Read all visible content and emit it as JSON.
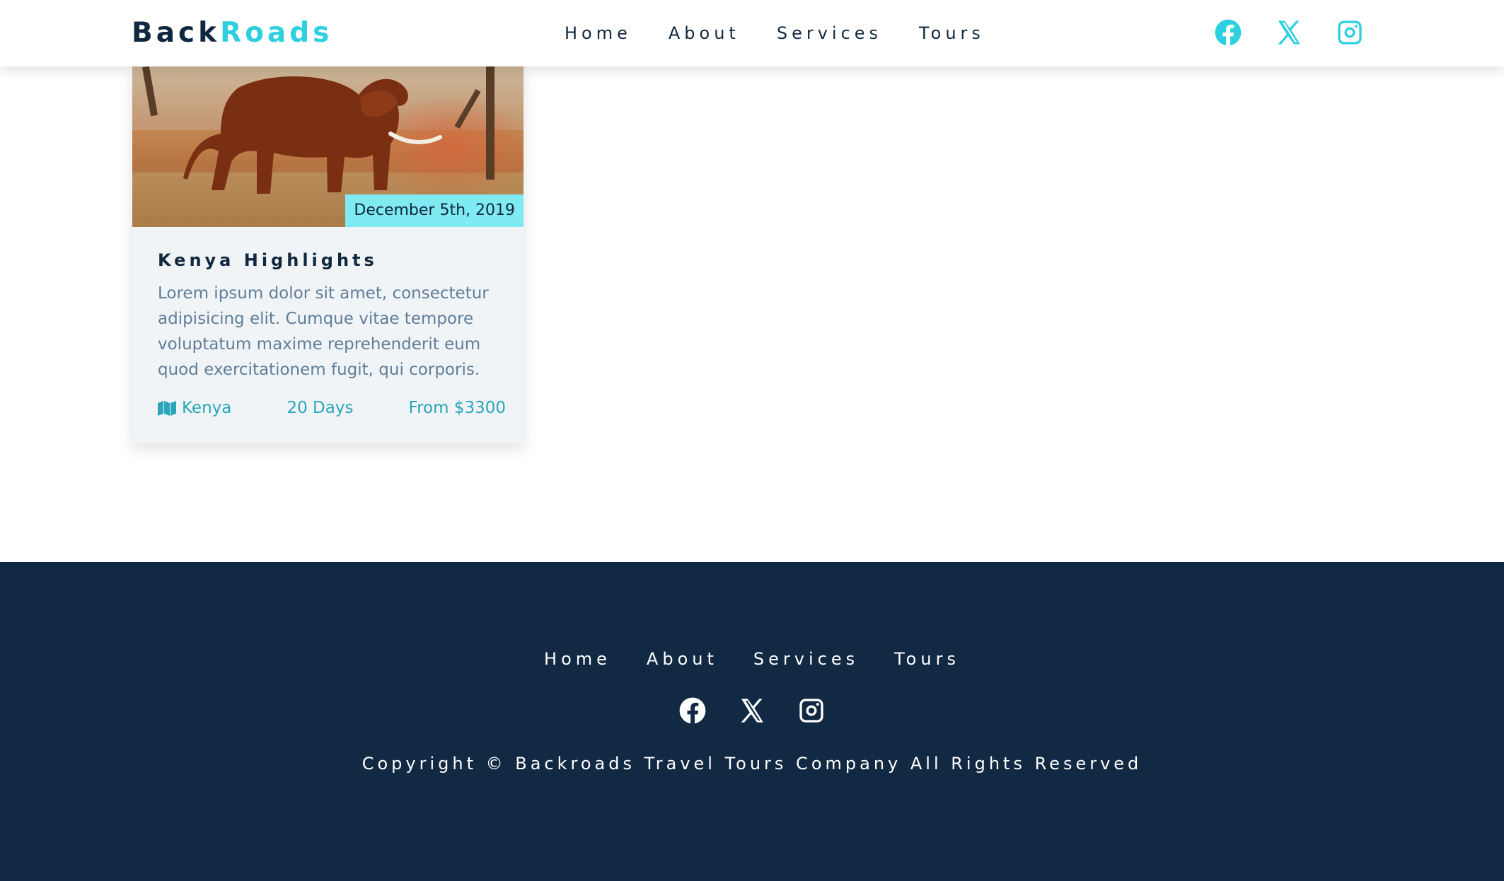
{
  "brand": {
    "part1": "Back",
    "part2": "Roads"
  },
  "nav": {
    "links": [
      "Home",
      "About",
      "Services",
      "Tours"
    ],
    "icons": [
      "facebook-icon",
      "x-icon",
      "instagram-icon"
    ]
  },
  "tour": {
    "date": "December 5th, 2019",
    "title": "Kenya Highlights",
    "description": "Lorem ipsum dolor sit amet, consectetur adipisicing elit. Cumque vitae tempore voluptatum maxime reprehenderit eum quod exercitationem fugit, qui corporis.",
    "location": "Kenya",
    "duration": "20 Days",
    "price": "From $3300",
    "image_alt": "elephant"
  },
  "footer": {
    "links": [
      "Home",
      "About",
      "Services",
      "Tours"
    ],
    "copyright": "Copyright © Backroads Travel Tours Company  All Rights Reserved"
  },
  "colors": {
    "primary": "#2ed0e0",
    "dark": "#10283f",
    "footer_bg": "#112943",
    "badge": "#7feaf1"
  }
}
